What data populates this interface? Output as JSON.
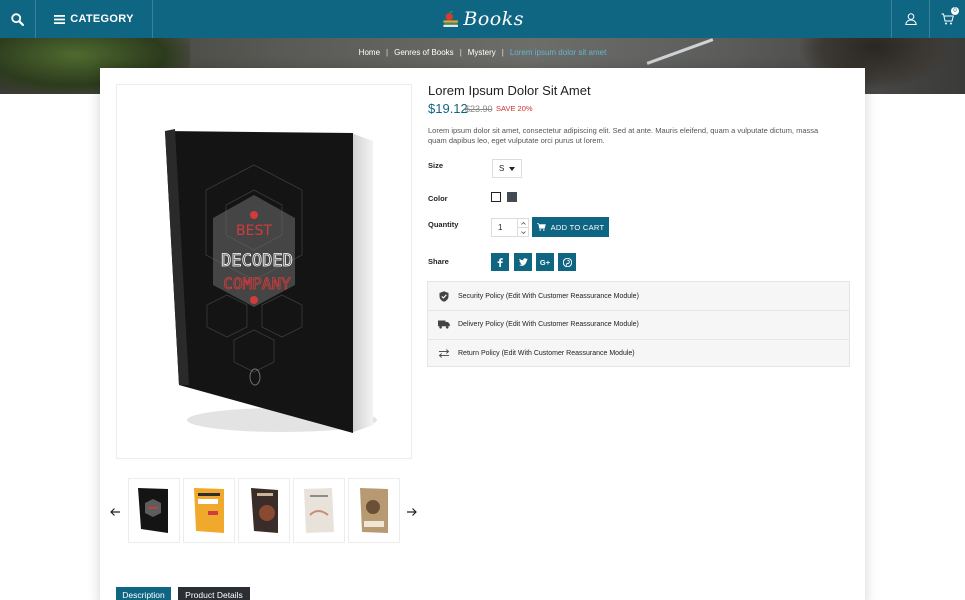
{
  "header": {
    "category_label": "CATEGORY",
    "logo_text": "Books",
    "cart_count": "0"
  },
  "breadcrumb": {
    "items": [
      "Home",
      "Genres of Books",
      "Mystery",
      "Lorem ipsum dolor sit amet"
    ]
  },
  "product": {
    "title": "Lorem Ipsum Dolor Sit Amet",
    "price": "$19.12",
    "old_price": "$23.90",
    "save_label": "SAVE 20%",
    "description": "Lorem ipsum dolor sit amet, consectetur adipiscing elit. Sed at ante. Mauris eleifend, quam a vulputate dictum, massa quam dapibus leo, eget vulputate orci purus ut lorem.",
    "cover_text_top": "BEST",
    "cover_text_main": "DECODED",
    "cover_text_bottom": "COMPANY"
  },
  "options": {
    "size_label": "Size",
    "size_value": "S",
    "color_label": "Color",
    "colors": [
      "#ffffff",
      "#434a54"
    ],
    "quantity_label": "Quantity",
    "quantity_value": "1",
    "add_to_cart": "ADD TO CART",
    "share_label": "Share",
    "share_icons": [
      "facebook-icon",
      "twitter-icon",
      "google-plus-icon",
      "pinterest-icon"
    ]
  },
  "reassurance": [
    {
      "icon": "shield-check-icon",
      "text": "Security Policy (Edit With Customer Reassurance Module)"
    },
    {
      "icon": "truck-icon",
      "text": "Delivery Policy (Edit With Customer Reassurance Module)"
    },
    {
      "icon": "swap-arrows-icon",
      "text": "Return Policy (Edit With Customer Reassurance Module)"
    }
  ],
  "tabs": [
    "Description",
    "Product Details"
  ],
  "colors": {
    "primary": "#0f6683",
    "accent_breadcrumb": "#5fb7d2",
    "sale": "#d0312d",
    "tab_inactive": "#2b2f33"
  }
}
